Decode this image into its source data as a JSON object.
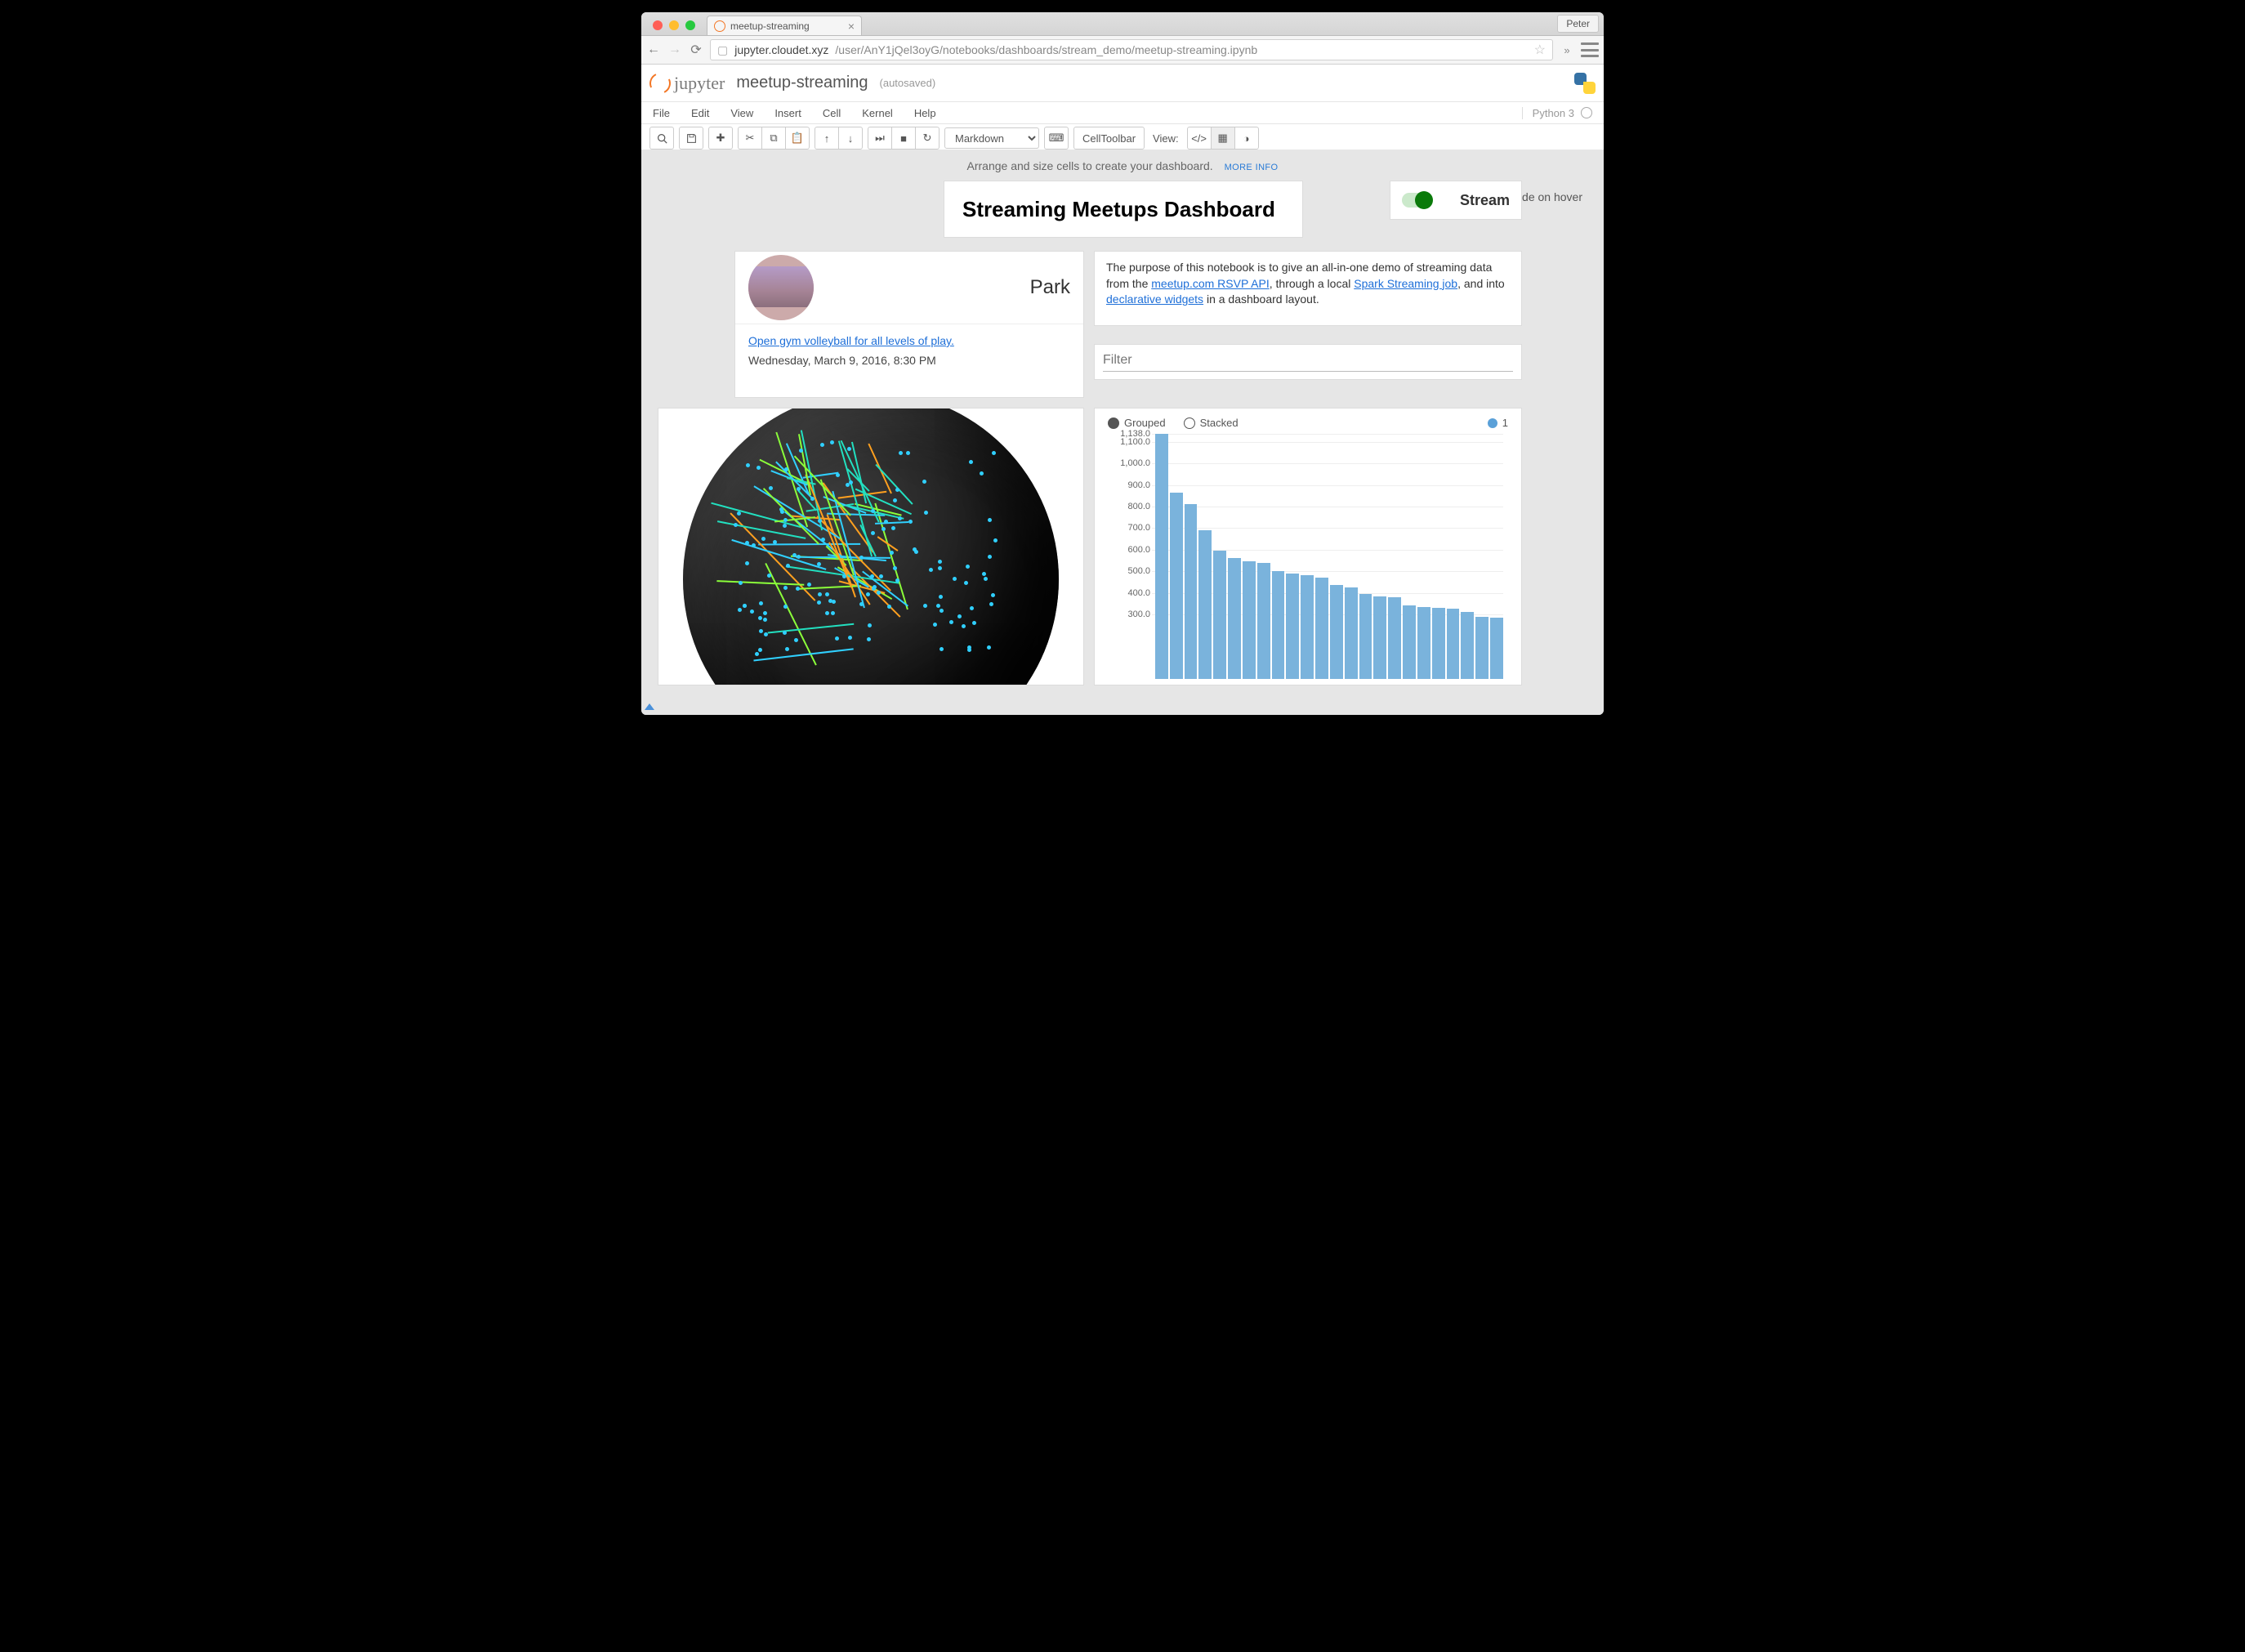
{
  "browser_tab": {
    "title": "meetup-streaming",
    "user_chip": "Peter"
  },
  "url": {
    "host": "jupyter.cloudet.xyz",
    "path": "/user/AnY1jQel3oyG/notebooks/dashboards/stream_demo/meetup-streaming.ipynb"
  },
  "jupyter": {
    "name": "meetup-streaming",
    "autosaved": "(autosaved)",
    "kernel": "Python 3"
  },
  "menus": [
    "File",
    "Edit",
    "View",
    "Insert",
    "Cell",
    "Kernel",
    "Help"
  ],
  "toolbar": {
    "cell_type_selected": "Markdown",
    "cell_toolbar_btn": "CellToolbar",
    "view_label": "View:"
  },
  "dashboard_hint": {
    "text": "Arrange and size cells to create your dashboard.",
    "more": "MORE INFO",
    "hover_label": "Show code on hover"
  },
  "title_card": "Streaming Meetups Dashboard",
  "stream_card": {
    "label": "Stream",
    "on": true
  },
  "event_card": {
    "location": "Park",
    "link": "Open gym volleyball for all levels of play.",
    "datetime": "Wednesday, March 9, 2016, 8:30 PM"
  },
  "purpose": {
    "pre": "The purpose of this notebook is to give an all-in-one demo of streaming data from the ",
    "l1": "meetup.com RSVP API",
    "mid1": ", through a local ",
    "l2": "Spark Streaming job",
    "mid2": ", and into ",
    "l3": "declarative widgets",
    "post": " in a dashboard layout."
  },
  "filter": {
    "placeholder": "Filter"
  },
  "chart_legend": {
    "grouped": "Grouped",
    "stacked": "Stacked",
    "series_name": "1"
  },
  "chart_data": {
    "type": "bar",
    "title": "",
    "xlabel": "",
    "ylabel": "",
    "ylim": [
      0,
      1138
    ],
    "y_ticks": [
      "1,138.0",
      "1,100.0",
      "1,000.0",
      "900.0",
      "800.0",
      "700.0",
      "600.0",
      "500.0",
      "400.0",
      "300.0"
    ],
    "series": [
      {
        "name": "1",
        "color": "#7ab3dc",
        "values": [
          1138,
          865,
          810,
          690,
          595,
          560,
          545,
          540,
          500,
          490,
          480,
          470,
          435,
          425,
          395,
          385,
          380,
          340,
          335,
          330,
          325,
          310,
          290,
          285
        ]
      }
    ]
  }
}
